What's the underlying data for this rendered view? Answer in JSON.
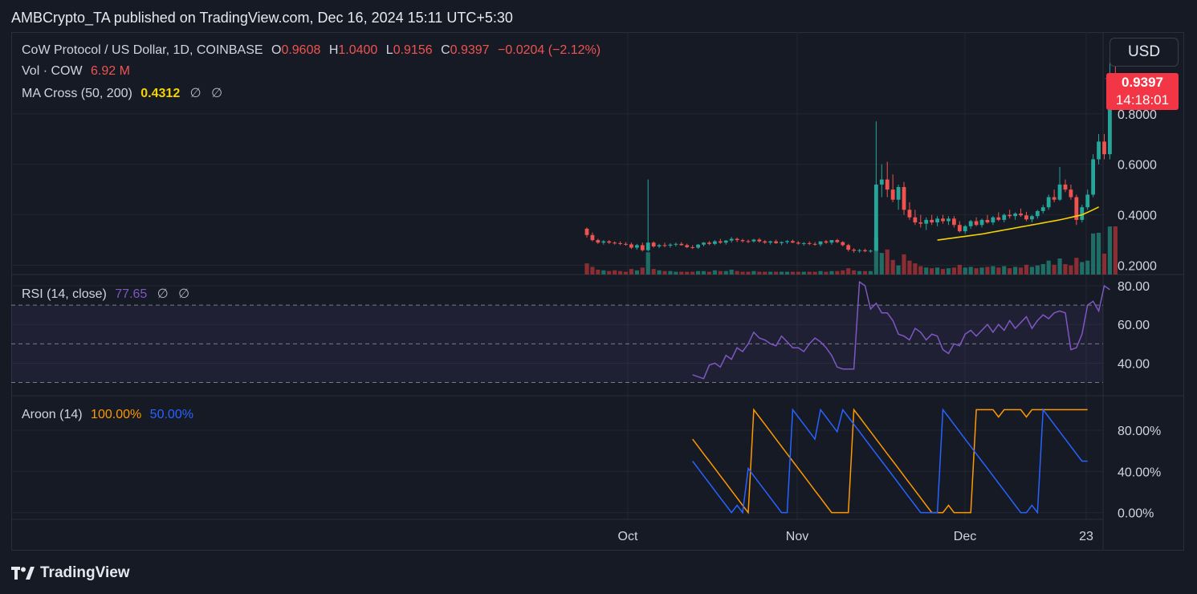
{
  "publisher": "AMBCrypto_TA published on TradingView.com, Dec 16, 2024 15:11 UTC+5:30",
  "footer": {
    "brand": "TradingView"
  },
  "currency_button": "USD",
  "price_tag": {
    "price": "0.9397",
    "countdown": "14:18:01"
  },
  "legend_main": {
    "symbol": "CoW Protocol / US Dollar, 1D, COINBASE",
    "o_label": "O",
    "o_value": "0.9608",
    "h_label": "H",
    "h_value": "1.0400",
    "l_label": "L",
    "l_value": "0.9156",
    "c_label": "C",
    "c_value": "0.9397",
    "change": "−0.0204 (−2.12%)"
  },
  "legend_vol": {
    "label": "Vol · COW",
    "value": "6.92 M"
  },
  "legend_ma": {
    "label": "MA Cross (50, 200)",
    "value": "0.4312",
    "extra1": "∅",
    "extra2": "∅"
  },
  "legend_rsi": {
    "label": "RSI (14, close)",
    "value": "77.65",
    "extra1": "∅",
    "extra2": "∅"
  },
  "legend_aroon": {
    "label": "Aroon (14)",
    "up": "100.00%",
    "down": "50.00%"
  },
  "colors": {
    "up": "#26a69a",
    "down": "#ef5350",
    "up_vol": "#1f6e66",
    "down_vol": "#8a2e33",
    "ma": "#f5d300",
    "rsi": "#7e57c2",
    "aroon_up": "#ff9800",
    "aroon_down": "#2962ff",
    "text": "#d1d4dc",
    "grid": "#222631"
  },
  "chart_data": [
    {
      "type": "candlestick",
      "title": "CoW Protocol / US Dollar, 1D, COINBASE",
      "x_ticks": [
        "Oct",
        "Nov",
        "Dec",
        "23"
      ],
      "y_ticks": [
        "0.2000",
        "0.4000",
        "0.6000",
        "0.8000"
      ],
      "ylim": [
        0.17,
        1.06
      ],
      "start_date": "2024-09-19",
      "series": [
        {
          "name": "OHLC",
          "candles": [
            [
              0.345,
              0.35,
              0.31,
              0.32
            ],
            [
              0.32,
              0.33,
              0.295,
              0.3
            ],
            [
              0.3,
              0.305,
              0.285,
              0.29
            ],
            [
              0.29,
              0.3,
              0.282,
              0.295
            ],
            [
              0.295,
              0.3,
              0.285,
              0.29
            ],
            [
              0.29,
              0.295,
              0.282,
              0.288
            ],
            [
              0.288,
              0.295,
              0.28,
              0.285
            ],
            [
              0.285,
              0.292,
              0.278,
              0.283
            ],
            [
              0.283,
              0.29,
              0.265,
              0.27
            ],
            [
              0.27,
              0.285,
              0.262,
              0.28
            ],
            [
              0.28,
              0.29,
              0.255,
              0.26
            ],
            [
              0.26,
              0.54,
              0.255,
              0.29
            ],
            [
              0.29,
              0.295,
              0.27,
              0.275
            ],
            [
              0.275,
              0.285,
              0.268,
              0.28
            ],
            [
              0.28,
              0.29,
              0.272,
              0.278
            ],
            [
              0.278,
              0.288,
              0.27,
              0.282
            ],
            [
              0.282,
              0.29,
              0.275,
              0.285
            ],
            [
              0.285,
              0.292,
              0.278,
              0.28
            ],
            [
              0.28,
              0.286,
              0.268,
              0.272
            ],
            [
              0.272,
              0.28,
              0.265,
              0.27
            ],
            [
              0.27,
              0.285,
              0.265,
              0.282
            ],
            [
              0.282,
              0.292,
              0.275,
              0.29
            ],
            [
              0.29,
              0.296,
              0.28,
              0.285
            ],
            [
              0.285,
              0.3,
              0.28,
              0.295
            ],
            [
              0.295,
              0.305,
              0.285,
              0.29
            ],
            [
              0.29,
              0.3,
              0.282,
              0.298
            ],
            [
              0.298,
              0.312,
              0.29,
              0.305
            ],
            [
              0.305,
              0.31,
              0.292,
              0.3
            ],
            [
              0.3,
              0.305,
              0.29,
              0.296
            ],
            [
              0.296,
              0.302,
              0.288,
              0.295
            ],
            [
              0.295,
              0.305,
              0.29,
              0.302
            ],
            [
              0.302,
              0.308,
              0.29,
              0.295
            ],
            [
              0.295,
              0.3,
              0.285,
              0.29
            ],
            [
              0.29,
              0.298,
              0.282,
              0.295
            ],
            [
              0.295,
              0.302,
              0.285,
              0.288
            ],
            [
              0.288,
              0.295,
              0.28,
              0.292
            ],
            [
              0.292,
              0.3,
              0.285,
              0.296
            ],
            [
              0.296,
              0.302,
              0.288,
              0.29
            ],
            [
              0.29,
              0.296,
              0.282,
              0.286
            ],
            [
              0.286,
              0.292,
              0.278,
              0.288
            ],
            [
              0.288,
              0.295,
              0.28,
              0.285
            ],
            [
              0.285,
              0.292,
              0.278,
              0.283
            ],
            [
              0.283,
              0.29,
              0.275,
              0.295
            ],
            [
              0.295,
              0.3,
              0.285,
              0.29
            ],
            [
              0.29,
              0.298,
              0.282,
              0.3
            ],
            [
              0.3,
              0.305,
              0.288,
              0.292
            ],
            [
              0.292,
              0.296,
              0.275,
              0.28
            ],
            [
              0.28,
              0.285,
              0.255,
              0.262
            ],
            [
              0.262,
              0.268,
              0.25,
              0.258
            ],
            [
              0.258,
              0.265,
              0.25,
              0.26
            ],
            [
              0.26,
              0.266,
              0.252,
              0.256
            ],
            [
              0.256,
              0.262,
              0.25,
              0.258
            ],
            [
              0.258,
              0.77,
              0.255,
              0.52
            ],
            [
              0.52,
              0.6,
              0.47,
              0.54
            ],
            [
              0.54,
              0.61,
              0.47,
              0.5
            ],
            [
              0.5,
              0.56,
              0.45,
              0.46
            ],
            [
              0.46,
              0.52,
              0.42,
              0.51
            ],
            [
              0.51,
              0.53,
              0.4,
              0.42
            ],
            [
              0.42,
              0.45,
              0.38,
              0.39
            ],
            [
              0.39,
              0.42,
              0.36,
              0.37
            ],
            [
              0.37,
              0.4,
              0.35,
              0.365
            ],
            [
              0.365,
              0.39,
              0.34,
              0.38
            ],
            [
              0.38,
              0.4,
              0.36,
              0.37
            ],
            [
              0.37,
              0.395,
              0.355,
              0.385
            ],
            [
              0.385,
              0.4,
              0.365,
              0.375
            ],
            [
              0.375,
              0.395,
              0.36,
              0.385
            ],
            [
              0.385,
              0.395,
              0.35,
              0.36
            ],
            [
              0.36,
              0.375,
              0.33,
              0.335
            ],
            [
              0.335,
              0.36,
              0.325,
              0.355
            ],
            [
              0.355,
              0.38,
              0.345,
              0.375
            ],
            [
              0.375,
              0.39,
              0.355,
              0.36
            ],
            [
              0.36,
              0.385,
              0.35,
              0.38
            ],
            [
              0.38,
              0.4,
              0.365,
              0.37
            ],
            [
              0.37,
              0.395,
              0.36,
              0.39
            ],
            [
              0.39,
              0.41,
              0.375,
              0.38
            ],
            [
              0.38,
              0.405,
              0.37,
              0.4
            ],
            [
              0.4,
              0.42,
              0.385,
              0.395
            ],
            [
              0.395,
              0.41,
              0.38,
              0.405
            ],
            [
              0.405,
              0.425,
              0.392,
              0.398
            ],
            [
              0.398,
              0.412,
              0.375,
              0.382
            ],
            [
              0.382,
              0.4,
              0.37,
              0.395
            ],
            [
              0.395,
              0.42,
              0.385,
              0.415
            ],
            [
              0.415,
              0.44,
              0.405,
              0.43
            ],
            [
              0.43,
              0.48,
              0.42,
              0.47
            ],
            [
              0.47,
              0.5,
              0.45,
              0.46
            ],
            [
              0.46,
              0.59,
              0.455,
              0.52
            ],
            [
              0.52,
              0.54,
              0.49,
              0.5
            ],
            [
              0.5,
              0.52,
              0.46,
              0.47
            ],
            [
              0.47,
              0.48,
              0.36,
              0.38
            ],
            [
              0.38,
              0.44,
              0.37,
              0.43
            ],
            [
              0.43,
              0.5,
              0.42,
              0.48
            ],
            [
              0.48,
              0.64,
              0.47,
              0.62
            ],
            [
              0.62,
              0.72,
              0.6,
              0.69
            ],
            [
              0.69,
              0.72,
              0.62,
              0.64
            ],
            [
              0.64,
              1.02,
              0.62,
              0.96
            ],
            [
              0.96,
              1.04,
              0.915,
              0.94
            ]
          ]
        },
        {
          "name": "MA Cross (50, 200)",
          "start_index": 63,
          "values": [
            0.3,
            0.303,
            0.306,
            0.309,
            0.312,
            0.315,
            0.318,
            0.321,
            0.324,
            0.328,
            0.332,
            0.336,
            0.34,
            0.344,
            0.348,
            0.352,
            0.356,
            0.36,
            0.364,
            0.368,
            0.372,
            0.376,
            0.38,
            0.385,
            0.39,
            0.395,
            0.4,
            0.41,
            0.42,
            0.431
          ]
        },
        {
          "name": "Vol · COW",
          "values": [
            1.6,
            1.1,
            0.7,
            0.6,
            0.5,
            0.6,
            0.5,
            0.4,
            0.8,
            0.6,
            1.0,
            3.2,
            0.8,
            0.6,
            0.5,
            0.5,
            0.4,
            0.4,
            0.4,
            0.4,
            0.5,
            0.5,
            0.4,
            0.6,
            0.5,
            0.5,
            0.7,
            0.5,
            0.4,
            0.4,
            0.5,
            0.4,
            0.4,
            0.4,
            0.4,
            0.4,
            0.4,
            0.4,
            0.4,
            0.4,
            0.4,
            0.4,
            0.5,
            0.4,
            0.5,
            0.5,
            0.6,
            0.9,
            0.6,
            0.5,
            0.5,
            0.5,
            5.3,
            3.1,
            3.6,
            2.1,
            1.3,
            2.9,
            2.0,
            1.6,
            1.2,
            1.0,
            0.9,
            1.0,
            0.8,
            0.9,
            1.0,
            1.4,
            1.0,
            1.1,
            0.9,
            1.0,
            1.1,
            1.2,
            1.0,
            1.2,
            0.9,
            1.1,
            1.0,
            1.4,
            1.1,
            1.3,
            1.5,
            2.0,
            1.4,
            2.3,
            1.5,
            1.3,
            2.4,
            1.8,
            2.0,
            5.9,
            6.0,
            3.0,
            6.9,
            6.92
          ]
        }
      ]
    },
    {
      "type": "line",
      "title": "RSI (14, close)",
      "y_ticks": [
        "40.00",
        "60.00",
        "80.00"
      ],
      "ylim": [
        24,
        85
      ],
      "bands": [
        30,
        50,
        70
      ],
      "series": [
        {
          "name": "RSI",
          "start_index": 19,
          "values": [
            34,
            33,
            32,
            39,
            40,
            38,
            44,
            42,
            48,
            46,
            50,
            56,
            53,
            52,
            50,
            49,
            54,
            51,
            48,
            48,
            46,
            50,
            53,
            51,
            48,
            44,
            38,
            37,
            37,
            37,
            82,
            80,
            68,
            71,
            66,
            66,
            62,
            55,
            54,
            52,
            58,
            56,
            52,
            55,
            54,
            47,
            45,
            50,
            49,
            55,
            57,
            54,
            57,
            60,
            56,
            60,
            57,
            62,
            58,
            61,
            64,
            58,
            62,
            65,
            63,
            66,
            67,
            66,
            47,
            48,
            55,
            70,
            72,
            67,
            80,
            78
          ]
        }
      ]
    },
    {
      "type": "line",
      "title": "Aroon (14)",
      "y_ticks": [
        "0.00%",
        "40.00%",
        "80.00%"
      ],
      "ylim": [
        -5,
        112
      ],
      "series": [
        {
          "name": "Aroon Up",
          "start_index": 19,
          "values": [
            71.4,
            64.3,
            57.1,
            50,
            42.9,
            35.7,
            28.6,
            21.4,
            14.3,
            7.1,
            0,
            100,
            92.9,
            85.7,
            78.6,
            71.4,
            64.3,
            57.1,
            50,
            42.9,
            35.7,
            28.6,
            21.4,
            14.3,
            7.1,
            0,
            0,
            0,
            0,
            100,
            92.9,
            85.7,
            78.6,
            71.4,
            64.3,
            57.1,
            50,
            42.9,
            35.7,
            28.6,
            21.4,
            14.3,
            7.1,
            0,
            0,
            0,
            7.1,
            0,
            0,
            0,
            0,
            100,
            100,
            100,
            100,
            92.9,
            100,
            100,
            100,
            100,
            92.9,
            100,
            100,
            100,
            100,
            100,
            100,
            100,
            100,
            100,
            100,
            100
          ]
        },
        {
          "name": "Aroon Down",
          "start_index": 19,
          "values": [
            50,
            42.9,
            35.7,
            28.6,
            21.4,
            14.3,
            7.1,
            0,
            7.1,
            0,
            42.9,
            35.7,
            28.6,
            21.4,
            14.3,
            7.1,
            0,
            0,
            100,
            92.9,
            85.7,
            78.6,
            71.4,
            100,
            92.9,
            85.7,
            78.6,
            100,
            92.9,
            85.7,
            78.6,
            71.4,
            64.3,
            57.1,
            50,
            42.9,
            35.7,
            28.6,
            21.4,
            14.3,
            7.1,
            0,
            0,
            0,
            0,
            100,
            92.9,
            85.7,
            78.6,
            71.4,
            64.3,
            57.1,
            50,
            42.9,
            35.7,
            28.6,
            21.4,
            14.3,
            7.1,
            0,
            0,
            7.1,
            0,
            100,
            92.9,
            85.7,
            78.6,
            71.4,
            64.3,
            57.1,
            50,
            50
          ]
        }
      ]
    }
  ]
}
